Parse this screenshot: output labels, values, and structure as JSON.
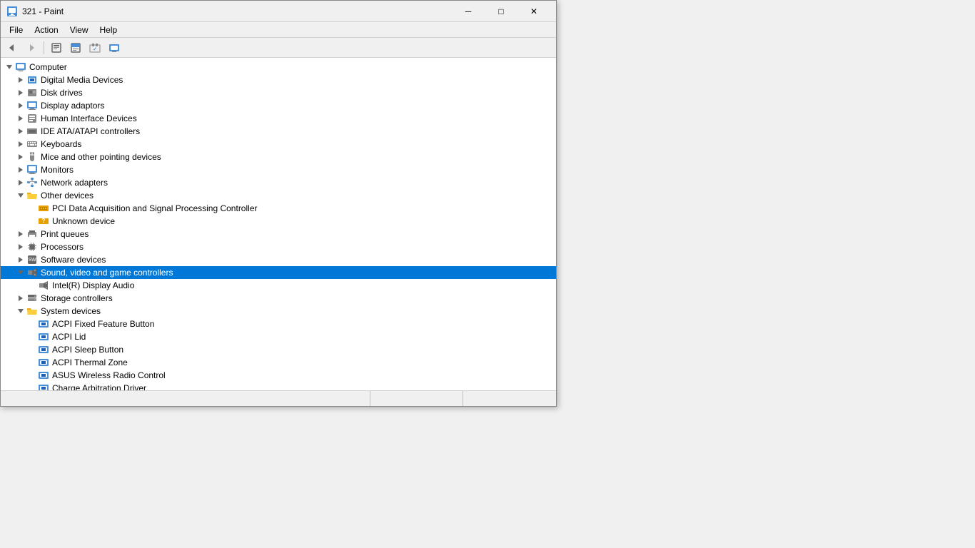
{
  "titlebar": {
    "title": "321 - Paint",
    "minimize_label": "─",
    "maximize_label": "□",
    "close_label": "✕"
  },
  "quickaccess": {
    "buttons": [
      "⟲",
      "⟳",
      "✎"
    ]
  },
  "menubar": {
    "items": [
      "File",
      "Action",
      "View",
      "Help"
    ]
  },
  "toolbar": {
    "back_label": "◄",
    "forward_label": "►",
    "icons": [
      "⊞",
      "⊟",
      "★",
      "⊠",
      "🖥"
    ]
  },
  "tree": {
    "items": [
      {
        "id": "computer",
        "label": "Computer",
        "level": 0,
        "expanded": true,
        "icon": "computer",
        "expandable": true
      },
      {
        "id": "digital-media",
        "label": "Digital Media Devices",
        "level": 1,
        "expanded": false,
        "icon": "digital",
        "expandable": true
      },
      {
        "id": "disk-drives",
        "label": "Disk drives",
        "level": 1,
        "expanded": false,
        "icon": "disk",
        "expandable": true
      },
      {
        "id": "display-adaptors",
        "label": "Display adaptors",
        "level": 1,
        "expanded": false,
        "icon": "display",
        "expandable": true
      },
      {
        "id": "human-interface",
        "label": "Human Interface Devices",
        "level": 1,
        "expanded": false,
        "icon": "hid",
        "expandable": true
      },
      {
        "id": "ide-atapi",
        "label": "IDE ATA/ATAPI controllers",
        "level": 1,
        "expanded": false,
        "icon": "ide",
        "expandable": true
      },
      {
        "id": "keyboards",
        "label": "Keyboards",
        "level": 1,
        "expanded": false,
        "icon": "keyboard",
        "expandable": true
      },
      {
        "id": "mice",
        "label": "Mice and other pointing devices",
        "level": 1,
        "expanded": false,
        "icon": "mouse",
        "expandable": true
      },
      {
        "id": "monitors",
        "label": "Monitors",
        "level": 1,
        "expanded": false,
        "icon": "monitor",
        "expandable": true
      },
      {
        "id": "network-adapters",
        "label": "Network adapters",
        "level": 1,
        "expanded": false,
        "icon": "network",
        "expandable": true
      },
      {
        "id": "other-devices",
        "label": "Other devices",
        "level": 1,
        "expanded": true,
        "icon": "folder-open",
        "expandable": true
      },
      {
        "id": "pci-data",
        "label": "PCI Data Acquisition and Signal Processing Controller",
        "level": 2,
        "expanded": false,
        "icon": "pci",
        "expandable": false
      },
      {
        "id": "unknown-device",
        "label": "Unknown device",
        "level": 2,
        "expanded": false,
        "icon": "unknown",
        "expandable": false
      },
      {
        "id": "print-queues",
        "label": "Print queues",
        "level": 1,
        "expanded": false,
        "icon": "print",
        "expandable": true
      },
      {
        "id": "processors",
        "label": "Processors",
        "level": 1,
        "expanded": false,
        "icon": "processor",
        "expandable": true
      },
      {
        "id": "software-devices",
        "label": "Software devices",
        "level": 1,
        "expanded": false,
        "icon": "software",
        "expandable": true
      },
      {
        "id": "sound-video",
        "label": "Sound, video and game controllers",
        "level": 1,
        "expanded": true,
        "icon": "audio",
        "expandable": true,
        "highlighted": true
      },
      {
        "id": "intel-display-audio",
        "label": "Intel(R) Display Audio",
        "level": 2,
        "expanded": false,
        "icon": "audio",
        "expandable": false
      },
      {
        "id": "storage-controllers",
        "label": "Storage controllers",
        "level": 1,
        "expanded": false,
        "icon": "storage",
        "expandable": true
      },
      {
        "id": "system-devices",
        "label": "System devices",
        "level": 1,
        "expanded": true,
        "icon": "folder-open",
        "expandable": true
      },
      {
        "id": "acpi-fixed-feature",
        "label": "ACPI Fixed Feature Button",
        "level": 2,
        "expanded": false,
        "icon": "acpi",
        "expandable": false
      },
      {
        "id": "acpi-lid",
        "label": "ACPI Lid",
        "level": 2,
        "expanded": false,
        "icon": "acpi",
        "expandable": false
      },
      {
        "id": "acpi-sleep",
        "label": "ACPI Sleep Button",
        "level": 2,
        "expanded": false,
        "icon": "acpi",
        "expandable": false
      },
      {
        "id": "acpi-thermal",
        "label": "ACPI Thermal Zone",
        "level": 2,
        "expanded": false,
        "icon": "acpi",
        "expandable": false
      },
      {
        "id": "asus-wireless",
        "label": "ASUS Wireless Radio Control",
        "level": 2,
        "expanded": false,
        "icon": "acpi",
        "expandable": false
      },
      {
        "id": "charge-arbitration",
        "label": "Charge Arbitration Driver",
        "level": 2,
        "expanded": false,
        "icon": "acpi",
        "expandable": false
      }
    ]
  },
  "statusbar": {
    "sections": [
      "",
      "",
      ""
    ]
  }
}
